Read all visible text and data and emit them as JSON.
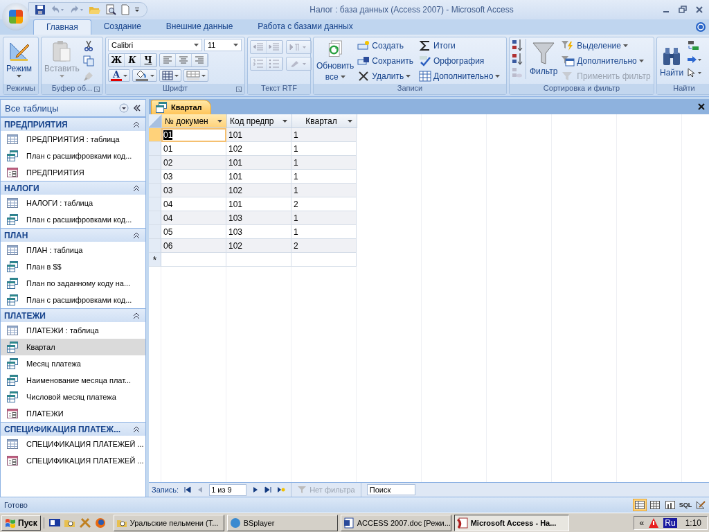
{
  "window": {
    "title": "Налог : база данных (Access 2007) - Microsoft Access"
  },
  "ribbon_tabs": [
    {
      "label": "Главная",
      "selected": true
    },
    {
      "label": "Создание",
      "selected": false
    },
    {
      "label": "Внешние данные",
      "selected": false
    },
    {
      "label": "Работа с базами данных",
      "selected": false
    }
  ],
  "ribbon_groups": [
    {
      "kind": "modes",
      "label": "Режимы",
      "large": {
        "label": "Режим"
      }
    },
    {
      "kind": "clipboard",
      "label": "Буфер об...",
      "large": {
        "label": "Вставить"
      }
    },
    {
      "kind": "font",
      "label": "Шрифт",
      "font": "Calibri",
      "size": "11",
      "styles": [
        "Ж",
        "К",
        "Ч"
      ],
      "color_glyph": "A"
    },
    {
      "kind": "rtf",
      "label": "Текст RTF"
    },
    {
      "kind": "records",
      "label": "Записи",
      "large": {
        "label": "Обновить",
        "label2": "все"
      },
      "commands": [
        {
          "label": "Создать",
          "dropdown": false,
          "disabled": false
        },
        {
          "label": "Сохранить",
          "dropdown": false,
          "disabled": false
        },
        {
          "label": "Удалить",
          "dropdown": true,
          "disabled": false
        },
        {
          "label": "Итоги",
          "dropdown": false,
          "disabled": false
        },
        {
          "label": "Орфография",
          "dropdown": false,
          "disabled": false
        },
        {
          "label": "Дополнительно",
          "dropdown": true,
          "disabled": false
        }
      ]
    },
    {
      "kind": "sort",
      "label": "Сортировка и фильтр",
      "large": {
        "label": "Фильтр"
      },
      "commands": [
        {
          "label": "Выделение",
          "dropdown": true,
          "disabled": false
        },
        {
          "label": "Дополнительно",
          "dropdown": true,
          "disabled": false
        },
        {
          "label": "Применить фильтр",
          "dropdown": false,
          "disabled": true
        }
      ]
    },
    {
      "kind": "find",
      "label": "Найти",
      "large": {
        "label": "Найти"
      }
    }
  ],
  "nav_pane": {
    "title": "Все таблицы",
    "groups": [
      {
        "title": "ПРЕДПРИЯТИЯ",
        "expanded": true,
        "items": [
          {
            "label": "ПРЕДПРИЯТИЯ : таблица",
            "kind": "table",
            "selected": false
          },
          {
            "label": "План с расшифровками код...",
            "kind": "query",
            "selected": false
          },
          {
            "label": "ПРЕДПРИЯТИЯ",
            "kind": "form",
            "selected": false
          }
        ]
      },
      {
        "title": "НАЛОГИ",
        "expanded": true,
        "items": [
          {
            "label": "НАЛОГИ : таблица",
            "kind": "table",
            "selected": false
          },
          {
            "label": "План с расшифровками код...",
            "kind": "query",
            "selected": false
          }
        ]
      },
      {
        "title": "ПЛАН",
        "expanded": true,
        "items": [
          {
            "label": "ПЛАН : таблица",
            "kind": "table",
            "selected": false
          },
          {
            "label": "План в $$",
            "kind": "query",
            "selected": false
          },
          {
            "label": "План по заданному коду на...",
            "kind": "query",
            "selected": false
          },
          {
            "label": "План с расшифровками код...",
            "kind": "query",
            "selected": false
          }
        ]
      },
      {
        "title": "ПЛАТЕЖИ",
        "expanded": true,
        "items": [
          {
            "label": "ПЛАТЕЖИ : таблица",
            "kind": "table",
            "selected": false
          },
          {
            "label": "Квартал",
            "kind": "query",
            "selected": true
          },
          {
            "label": "Месяц платежа",
            "kind": "query",
            "selected": false
          },
          {
            "label": "Наименование месяца плат...",
            "kind": "query",
            "selected": false
          },
          {
            "label": "Числовой месяц платежа",
            "kind": "query",
            "selected": false
          },
          {
            "label": "ПЛАТЕЖИ",
            "kind": "form",
            "selected": false
          }
        ]
      },
      {
        "title": "СПЕЦИФИКАЦИЯ ПЛАТЕЖ...",
        "expanded": true,
        "items": [
          {
            "label": "СПЕЦИФИКАЦИЯ ПЛАТЕЖЕЙ ...",
            "kind": "table",
            "selected": false
          },
          {
            "label": "СПЕЦИФИКАЦИЯ ПЛАТЕЖЕЙ ...",
            "kind": "form",
            "selected": false
          }
        ]
      }
    ]
  },
  "document_tab": {
    "label": "Квартал"
  },
  "table": {
    "columns": [
      "№ докумен",
      "Код предпр",
      "Квартал"
    ],
    "rows": [
      {
        "cells": [
          "01",
          "101",
          "1"
        ],
        "selected": true
      },
      {
        "cells": [
          "01",
          "102",
          "1"
        ],
        "selected": false
      },
      {
        "cells": [
          "02",
          "101",
          "1"
        ],
        "selected": false
      },
      {
        "cells": [
          "03",
          "101",
          "1"
        ],
        "selected": false
      },
      {
        "cells": [
          "03",
          "102",
          "1"
        ],
        "selected": false
      },
      {
        "cells": [
          "04",
          "101",
          "2"
        ],
        "selected": false
      },
      {
        "cells": [
          "04",
          "103",
          "1"
        ],
        "selected": false
      },
      {
        "cells": [
          "05",
          "103",
          "1"
        ],
        "selected": false
      },
      {
        "cells": [
          "06",
          "102",
          "2"
        ],
        "selected": false
      }
    ],
    "new_row_marker": "*"
  },
  "record_nav": {
    "label": "Запись:",
    "position": "1 из 9",
    "filter": "Нет фильтра",
    "search_placeholder": "Поиск"
  },
  "status_bar": {
    "text": "Готово",
    "sql_label": "SQL"
  },
  "taskbar": {
    "start": "Пуск",
    "tasks": [
      {
        "label": "Уральские пельмени (Т...",
        "selected": false
      },
      {
        "label": "BSplayer",
        "selected": false
      },
      {
        "label": "ACCESS 2007.doc [Режи...",
        "selected": false
      },
      {
        "label": "Microsoft Access - На...",
        "selected": true
      }
    ],
    "tray_expand": "«",
    "language": "Ru",
    "time": "1:10"
  }
}
